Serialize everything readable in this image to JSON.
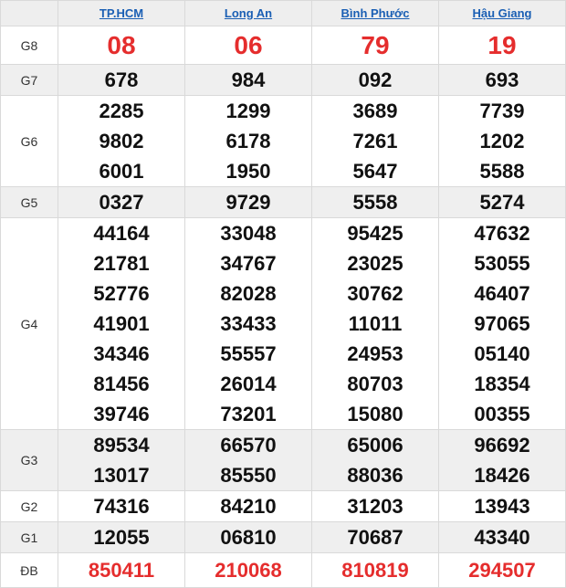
{
  "provinces": [
    "TP.HCM",
    "Long An",
    "Bình Phước",
    "Hậu Giang"
  ],
  "rows": {
    "G8": {
      "label": "G8",
      "values": [
        [
          "08"
        ],
        [
          "06"
        ],
        [
          "79"
        ],
        [
          "19"
        ]
      ]
    },
    "G7": {
      "label": "G7",
      "values": [
        [
          "678"
        ],
        [
          "984"
        ],
        [
          "092"
        ],
        [
          "693"
        ]
      ]
    },
    "G6": {
      "label": "G6",
      "values": [
        [
          "2285",
          "9802",
          "6001"
        ],
        [
          "1299",
          "6178",
          "1950"
        ],
        [
          "3689",
          "7261",
          "5647"
        ],
        [
          "7739",
          "1202",
          "5588"
        ]
      ]
    },
    "G5": {
      "label": "G5",
      "values": [
        [
          "0327"
        ],
        [
          "9729"
        ],
        [
          "5558"
        ],
        [
          "5274"
        ]
      ]
    },
    "G4": {
      "label": "G4",
      "values": [
        [
          "44164",
          "21781",
          "52776",
          "41901",
          "34346",
          "81456",
          "39746"
        ],
        [
          "33048",
          "34767",
          "82028",
          "33433",
          "55557",
          "26014",
          "73201"
        ],
        [
          "95425",
          "23025",
          "30762",
          "11011",
          "24953",
          "80703",
          "15080"
        ],
        [
          "47632",
          "53055",
          "46407",
          "97065",
          "05140",
          "18354",
          "00355"
        ]
      ]
    },
    "G3": {
      "label": "G3",
      "values": [
        [
          "89534",
          "13017"
        ],
        [
          "66570",
          "85550"
        ],
        [
          "65006",
          "88036"
        ],
        [
          "96692",
          "18426"
        ]
      ]
    },
    "G2": {
      "label": "G2",
      "values": [
        [
          "74316"
        ],
        [
          "84210"
        ],
        [
          "31203"
        ],
        [
          "13943"
        ]
      ]
    },
    "G1": {
      "label": "G1",
      "values": [
        [
          "12055"
        ],
        [
          "06810"
        ],
        [
          "70687"
        ],
        [
          "43340"
        ]
      ]
    },
    "DB": {
      "label": "ĐB",
      "values": [
        [
          "850411"
        ],
        [
          "210068"
        ],
        [
          "810819"
        ],
        [
          "294507"
        ]
      ]
    }
  },
  "colors": {
    "accent_red": "#e52d2d",
    "link_blue": "#1a5fb4",
    "shade": "#efefef"
  }
}
